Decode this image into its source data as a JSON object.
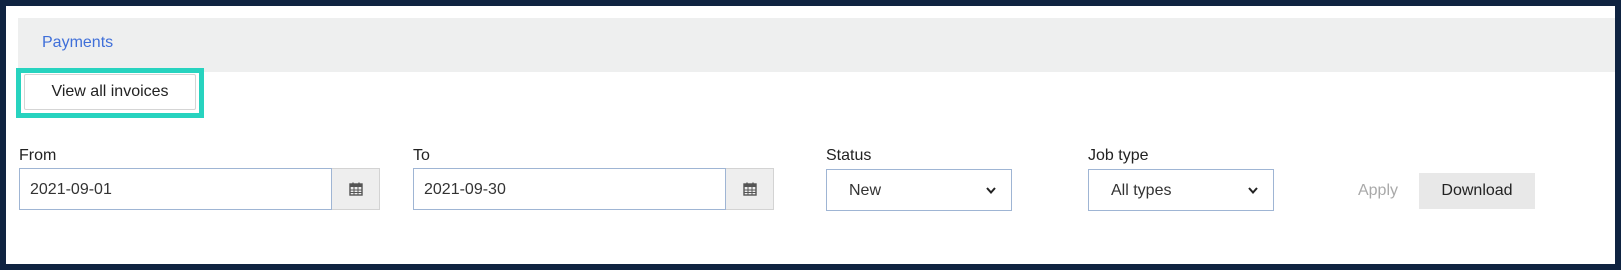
{
  "breadcrumb": {
    "label": "Payments"
  },
  "actions": {
    "view_all_invoices_label": "View all invoices"
  },
  "filters": {
    "from": {
      "label": "From",
      "value": "2021-09-01",
      "icon": "calendar-icon"
    },
    "to": {
      "label": "To",
      "value": "2021-09-30",
      "icon": "calendar-icon"
    },
    "status": {
      "label": "Status",
      "selected": "New",
      "icon": "chevron-down-icon"
    },
    "job_type": {
      "label": "Job type",
      "selected": "All types",
      "icon": "chevron-down-icon"
    }
  },
  "buttons": {
    "apply_label": "Apply",
    "download_label": "Download"
  },
  "colors": {
    "frame_border": "#0f2341",
    "highlight": "#27d3bf",
    "link": "#3f6fd9",
    "input_border": "#9fb5d4"
  }
}
